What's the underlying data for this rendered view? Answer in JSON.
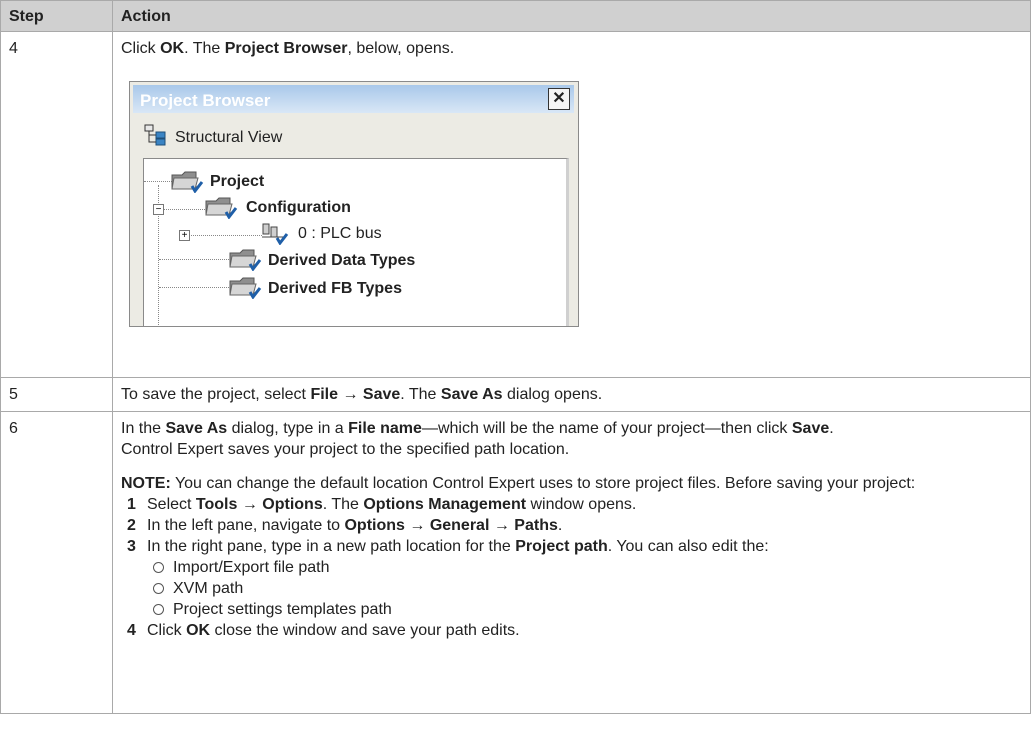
{
  "table": {
    "headers": {
      "step": "Step",
      "action": "Action"
    }
  },
  "rows": {
    "r4": {
      "step": "4",
      "t1": "Click ",
      "b1": "OK",
      "t2": ". The ",
      "b2": "Project Browser",
      "t3": ", below, opens."
    },
    "r5": {
      "step": "5",
      "t1": "To save the project, select ",
      "b1": "File → Save",
      "t2": ". The ",
      "b2": "Save As",
      "t3": " dialog opens."
    },
    "r6": {
      "step": "6",
      "p1_t1": "In the ",
      "p1_b1": "Save As",
      "p1_t2": " dialog, type in a ",
      "p1_b2": "File name",
      "p1_t3": "—which will be the name of your project—then click ",
      "p1_b3": "Save",
      "p1_t4": ".",
      "p2": "Control Expert saves your project to the specified path location.",
      "note_label": "NOTE:",
      "note_text": " You can change the default location Control Expert uses to store project files. Before saving your project:",
      "steps": [
        {
          "num": "1",
          "t1": "Select ",
          "b1": "Tools → Options",
          "t2": ". The ",
          "b2": "Options Management",
          "t3": " window opens."
        },
        {
          "num": "2",
          "t1": "In the left pane, navigate to ",
          "b1": "Options → General → Paths",
          "t2": "."
        },
        {
          "num": "3",
          "t1": "In the right pane, type in a new path location for the ",
          "b1": "Project path",
          "t2": ". You can also edit the:"
        },
        {
          "num": "4",
          "t1": "Click ",
          "b1": "OK",
          "t2": " close the window and save your path edits."
        }
      ],
      "options": [
        "Import/Export file path",
        "XVM path",
        "Project settings templates path"
      ]
    }
  },
  "dialog": {
    "title": "Project Browser",
    "close_glyph": "✕",
    "view_label": "Structural View",
    "tree": {
      "project": "Project",
      "configuration": "Configuration",
      "plc_bus": "0 : PLC bus",
      "derived_data_types": "Derived Data Types",
      "derived_fb_types": "Derived FB Types",
      "expand_minus": "−",
      "expand_plus": "+"
    },
    "icons": [
      "structural-view-icon",
      "folder-icon",
      "plc-bus-icon",
      "close-icon"
    ]
  }
}
